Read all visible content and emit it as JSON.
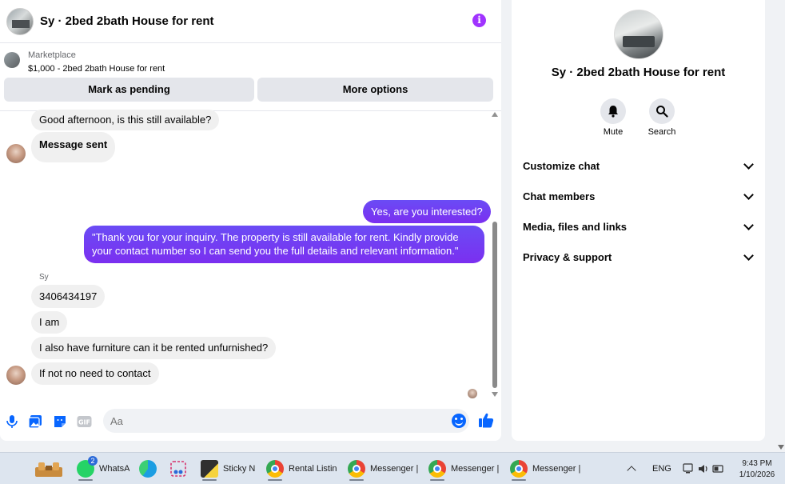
{
  "header": {
    "title": "Sy · 2bed 2bath House for rent"
  },
  "marketplace": {
    "label": "Marketplace",
    "listing": "$1,000 - 2bed 2bath House for rent",
    "mark_pending_label": "Mark as pending",
    "more_options_label": "More options"
  },
  "messages": {
    "m1": "Good afternoon, is this still available?",
    "m2": "Message sent",
    "m3": "Yes, are you interested?",
    "m4_line1": "\"Thank you for your inquiry. The property is still available for rent. Kindly provide",
    "m4_line2": "your contact number so I can send you the full details and relevant information.\"",
    "sender_name": "Sy",
    "m5": "3406434197",
    "m6": "I am",
    "m7": "I also have furniture can it be rented unfurnished?",
    "m8": "If not no need to contact"
  },
  "composer": {
    "placeholder": "Aa"
  },
  "details": {
    "title": "Sy · 2bed 2bath House for rent",
    "mute_label": "Mute",
    "search_label": "Search",
    "sections": [
      "Customize chat",
      "Chat members",
      "Media, files and links",
      "Privacy & support"
    ]
  },
  "taskbar": {
    "whatsapp_label": "WhatsA",
    "whatsapp_badge": "2",
    "sticky_label": "Sticky N",
    "rental_label": "Rental Listin",
    "messenger1_label": "Messenger |",
    "messenger2_label": "Messenger |",
    "messenger3_label": "Messenger |",
    "lang": "ENG",
    "time": "9:43 PM",
    "date": "1/10/2026"
  },
  "colors": {
    "accent": "#0866ff",
    "outgoing_bubble": "#7a3ff2",
    "info_icon": "#a033ff"
  }
}
